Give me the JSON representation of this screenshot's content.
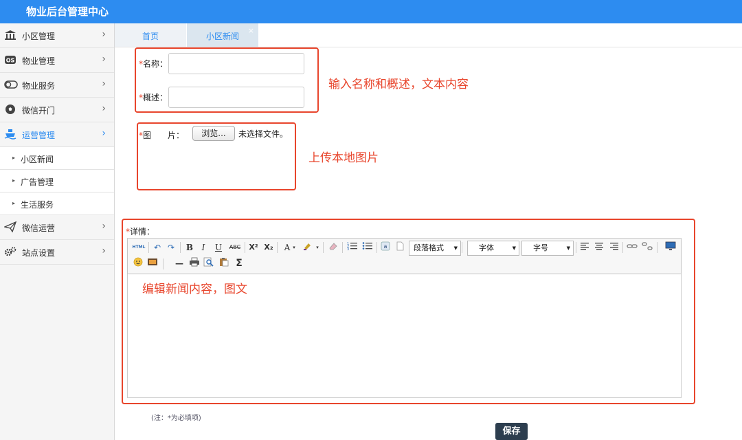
{
  "app": {
    "title": "物业后台管理中心"
  },
  "sidebar": {
    "items": [
      {
        "label": "小区管理",
        "icon": "bank-icon"
      },
      {
        "label": "物业管理",
        "icon": "os-icon"
      },
      {
        "label": "物业服务",
        "icon": "toggle-icon"
      },
      {
        "label": "微信开门",
        "icon": "soccer-ball-icon"
      },
      {
        "label": "运营管理",
        "icon": "ship-icon",
        "active": true
      },
      {
        "label": "微信运营",
        "icon": "send-icon"
      },
      {
        "label": "站点设置",
        "icon": "gears-icon"
      }
    ],
    "subitems": [
      {
        "label": "小区新闻"
      },
      {
        "label": "广告管理"
      },
      {
        "label": "生活服务"
      }
    ],
    "arrow": "›",
    "sub_marker": "▸"
  },
  "tabs": [
    {
      "label": "首页"
    },
    {
      "label": "小区新闻",
      "close": "×"
    }
  ],
  "form": {
    "required_mark": "*",
    "name_label": "名称：",
    "summary_label": "概述：",
    "image_label": "图　　片：",
    "browse_button": "浏览...",
    "no_file_text": "未选择文件。",
    "detail_label": "详情：",
    "note": "(注：*为必填项)",
    "save_button": "保存"
  },
  "editor": {
    "paragraph_format": "段落格式",
    "font_family": "字体",
    "font_size": "字号",
    "html_label": "HTML",
    "bold": "B",
    "italic": "I",
    "underline": "U",
    "strike": "ABC",
    "sup": "X²",
    "sub": "X₂",
    "font_color": "A",
    "hr": "—",
    "sigma": "Σ"
  },
  "annotations": {
    "name_summary": "输入名称和概述，文本内容",
    "upload": "上传本地图片",
    "edit": "编辑新闻内容，图文"
  },
  "colors": {
    "primary": "#2d8cf0",
    "annotation": "#e8452c",
    "save_bg": "#2d3e4f"
  }
}
